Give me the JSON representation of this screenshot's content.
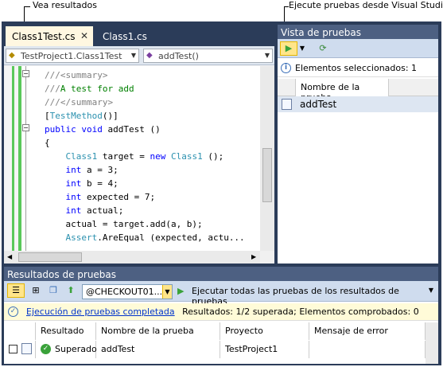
{
  "callouts": {
    "results": "Vea resultados",
    "run": "Ejecute pruebas desde Visual Studio"
  },
  "editor": {
    "tabs": [
      {
        "label": "Class1Test.cs",
        "active": true
      },
      {
        "label": "Class1.cs",
        "active": false
      }
    ],
    "close_glyph": "✕",
    "class_combo": "TestProject1.Class1Test",
    "member_combo": "addTest()",
    "code_lines": [
      {
        "parts": [
          {
            "t": "///",
            "c": "gr"
          },
          {
            "t": "<summary>",
            "c": "gr"
          }
        ]
      },
      {
        "parts": [
          {
            "t": "///",
            "c": "gr"
          },
          {
            "t": "A test for add",
            "c": "cm"
          }
        ]
      },
      {
        "parts": [
          {
            "t": "///",
            "c": "gr"
          },
          {
            "t": "</summary>",
            "c": "gr"
          }
        ]
      },
      {
        "parts": [
          {
            "t": "[",
            "c": ""
          },
          {
            "t": "TestMethod",
            "c": "ty"
          },
          {
            "t": "()]",
            "c": ""
          }
        ]
      },
      {
        "parts": [
          {
            "t": "public",
            "c": "kw"
          },
          {
            "t": " ",
            "c": ""
          },
          {
            "t": "void",
            "c": "kw"
          },
          {
            "t": " addTest ()",
            "c": ""
          }
        ]
      },
      {
        "parts": [
          {
            "t": "{",
            "c": ""
          }
        ]
      },
      {
        "parts": [
          {
            "t": "    ",
            "c": ""
          },
          {
            "t": "Class1",
            "c": "ty"
          },
          {
            "t": " target = ",
            "c": ""
          },
          {
            "t": "new",
            "c": "kw"
          },
          {
            "t": " ",
            "c": ""
          },
          {
            "t": "Class1",
            "c": "ty"
          },
          {
            "t": " ();",
            "c": ""
          }
        ]
      },
      {
        "parts": [
          {
            "t": "    ",
            "c": ""
          },
          {
            "t": "int",
            "c": "kw"
          },
          {
            "t": " a = 3;",
            "c": ""
          }
        ]
      },
      {
        "parts": [
          {
            "t": "    ",
            "c": ""
          },
          {
            "t": "int",
            "c": "kw"
          },
          {
            "t": " b = 4;",
            "c": ""
          }
        ]
      },
      {
        "parts": [
          {
            "t": "    ",
            "c": ""
          },
          {
            "t": "int",
            "c": "kw"
          },
          {
            "t": " expected = 7;",
            "c": ""
          }
        ]
      },
      {
        "parts": [
          {
            "t": "    ",
            "c": ""
          },
          {
            "t": "int",
            "c": "kw"
          },
          {
            "t": " actual;",
            "c": ""
          }
        ]
      },
      {
        "parts": [
          {
            "t": "    actual = target.add(a, b);",
            "c": ""
          }
        ]
      },
      {
        "parts": [
          {
            "t": "    ",
            "c": ""
          },
          {
            "t": "Assert",
            "c": "ty"
          },
          {
            "t": ".AreEqual (expected, actu...",
            "c": ""
          }
        ]
      }
    ]
  },
  "test_view": {
    "title": "Vista de pruebas",
    "selected_info": "Elementos seleccionados: 1",
    "column_header": "Nombre de la prueba",
    "tests": [
      "addTest"
    ]
  },
  "results": {
    "title": "Resultados de pruebas",
    "run_combo": "@CHECKOUT01...",
    "run_all_label": "Ejecutar todas las pruebas de los resultados de pruebas",
    "status_link": "Ejecución de pruebas completada",
    "status_text": "Resultados: 1/2 superada;  Elementos comprobados: 0",
    "columns": [
      "Resultado",
      "Nombre de la prueba",
      "Proyecto",
      "Mensaje de error"
    ],
    "rows": [
      {
        "result": "Superado",
        "test_name": "addTest",
        "project": "TestProject1",
        "error": ""
      }
    ]
  },
  "colors": {
    "frame": "#2b3c59",
    "toolbar": "#cfdcee",
    "highlight": "#ffe58a",
    "pass": "#3aa23a"
  }
}
